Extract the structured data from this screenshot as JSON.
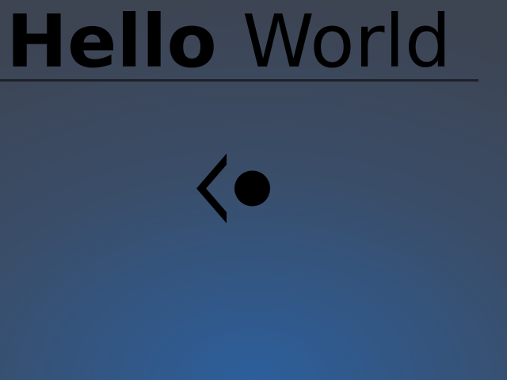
{
  "header": {
    "title_bold": "Hello",
    "title_regular": "World"
  },
  "icons": {
    "back": "chevron-left-icon",
    "indicator": "dot-icon"
  },
  "colors": {
    "text": "#000000",
    "rule": "#1f2128",
    "background_top": "#3d4452",
    "background_bottom": "#2c5f9c"
  }
}
